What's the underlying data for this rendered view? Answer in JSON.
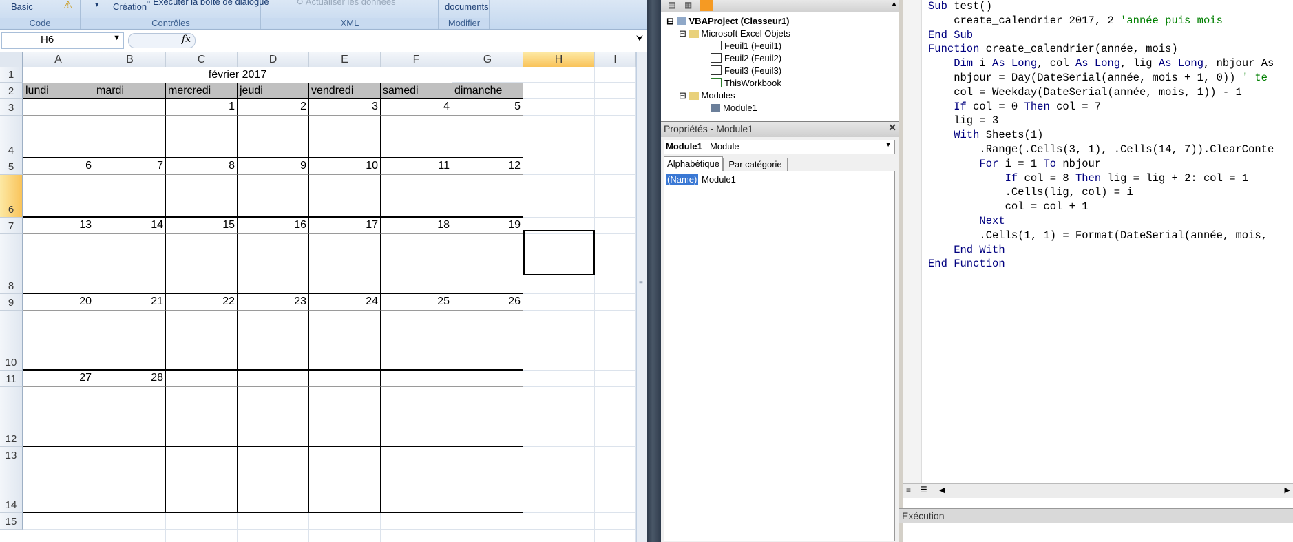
{
  "ribbon": {
    "groups": [
      {
        "label": "Code"
      },
      {
        "label": "Contrôles"
      },
      {
        "label": "XML"
      },
      {
        "label": "Modifier"
      }
    ],
    "basic": "Basic",
    "creation": "Création",
    "dialog": "Exécuter la boîte de dialogue",
    "refresh": "Actualiser les données",
    "documents": "documents"
  },
  "formula_bar": {
    "name_box": "H6",
    "fx": "fx",
    "formula": ""
  },
  "sheet": {
    "columns": [
      "A",
      "B",
      "C",
      "D",
      "E",
      "F",
      "G",
      "H",
      "I"
    ],
    "rows": [
      "1",
      "2",
      "3",
      "4",
      "5",
      "6",
      "7",
      "8",
      "9",
      "10",
      "11",
      "12",
      "13",
      "14",
      "15"
    ],
    "title": "février  2017",
    "days": [
      "lundi",
      "mardi",
      "mercredi",
      "jeudi",
      "vendredi",
      "samedi",
      "dimanche"
    ],
    "weeks": [
      [
        "",
        "",
        "1",
        "2",
        "3",
        "4",
        "5"
      ],
      [
        "6",
        "7",
        "8",
        "9",
        "10",
        "11",
        "12"
      ],
      [
        "13",
        "14",
        "15",
        "16",
        "17",
        "18",
        "19"
      ],
      [
        "20",
        "21",
        "22",
        "23",
        "24",
        "25",
        "26"
      ],
      [
        "27",
        "28",
        "",
        "",
        "",
        "",
        ""
      ],
      [
        "",
        "",
        "",
        "",
        "",
        "",
        ""
      ]
    ],
    "selected_cell": "H6"
  },
  "vbe": {
    "project": {
      "root": "VBAProject (Classeur1)",
      "objects_folder": "Microsoft Excel Objets",
      "sheets": [
        "Feuil1 (Feuil1)",
        "Feuil2 (Feuil2)",
        "Feuil3 (Feuil3)",
        "ThisWorkbook"
      ],
      "modules_folder": "Modules",
      "module": "Module1"
    },
    "properties": {
      "title": "Propriétés - Module1",
      "object": "Module1",
      "object_type": "Module",
      "tab_alpha": "Alphabétique",
      "tab_cat": "Par catégorie",
      "name_key": "(Name)",
      "name_value": "Module1",
      "close": "✕"
    },
    "execution_title": "Exécution",
    "code_lines": [
      [
        {
          "t": "Sub ",
          "k": "kw"
        },
        {
          "t": "test()",
          "k": ""
        }
      ],
      [
        {
          "t": "    create_calendrier 2017, 2 ",
          "k": ""
        },
        {
          "t": "'année puis mois",
          "k": "cm"
        }
      ],
      [
        {
          "t": "End Sub",
          "k": "kw"
        }
      ],
      [
        {
          "t": "Function ",
          "k": "kw"
        },
        {
          "t": "create_calendrier(année, mois)",
          "k": ""
        }
      ],
      [
        {
          "t": "    Dim ",
          "k": "kw"
        },
        {
          "t": "i ",
          "k": ""
        },
        {
          "t": "As Long",
          "k": "kw"
        },
        {
          "t": ", col ",
          "k": ""
        },
        {
          "t": "As Long",
          "k": "kw"
        },
        {
          "t": ", lig ",
          "k": ""
        },
        {
          "t": "As Long",
          "k": "kw"
        },
        {
          "t": ", nbjour As",
          "k": ""
        }
      ],
      [
        {
          "t": "    nbjour = Day(DateSerial(année, mois + 1, 0)) ",
          "k": ""
        },
        {
          "t": "' te",
          "k": "cm"
        }
      ],
      [
        {
          "t": "    col = Weekday(DateSerial(année, mois, 1)) - 1",
          "k": ""
        }
      ],
      [
        {
          "t": "    If ",
          "k": "kw"
        },
        {
          "t": "col = 0 ",
          "k": ""
        },
        {
          "t": "Then ",
          "k": "kw"
        },
        {
          "t": "col = 7",
          "k": ""
        }
      ],
      [
        {
          "t": "    lig = 3",
          "k": ""
        }
      ],
      [
        {
          "t": "    With ",
          "k": "kw"
        },
        {
          "t": "Sheets(1)",
          "k": ""
        }
      ],
      [
        {
          "t": "        .Range(.Cells(3, 1), .Cells(14, 7)).ClearConte",
          "k": ""
        }
      ],
      [
        {
          "t": "        For ",
          "k": "kw"
        },
        {
          "t": "i = 1 ",
          "k": ""
        },
        {
          "t": "To ",
          "k": "kw"
        },
        {
          "t": "nbjour",
          "k": ""
        }
      ],
      [
        {
          "t": "            If ",
          "k": "kw"
        },
        {
          "t": "col = 8 ",
          "k": ""
        },
        {
          "t": "Then ",
          "k": "kw"
        },
        {
          "t": "lig = lig + 2: col = 1",
          "k": ""
        }
      ],
      [
        {
          "t": "            .Cells(lig, col) = i",
          "k": ""
        }
      ],
      [
        {
          "t": "            col = col + 1",
          "k": ""
        }
      ],
      [
        {
          "t": "        Next",
          "k": "kw"
        }
      ],
      [
        {
          "t": "        .Cells(1, 1) = Format(DateSerial(année, mois,",
          "k": ""
        }
      ],
      [
        {
          "t": "    End With",
          "k": "kw"
        }
      ],
      [
        {
          "t": "End Function",
          "k": "kw"
        }
      ]
    ]
  }
}
